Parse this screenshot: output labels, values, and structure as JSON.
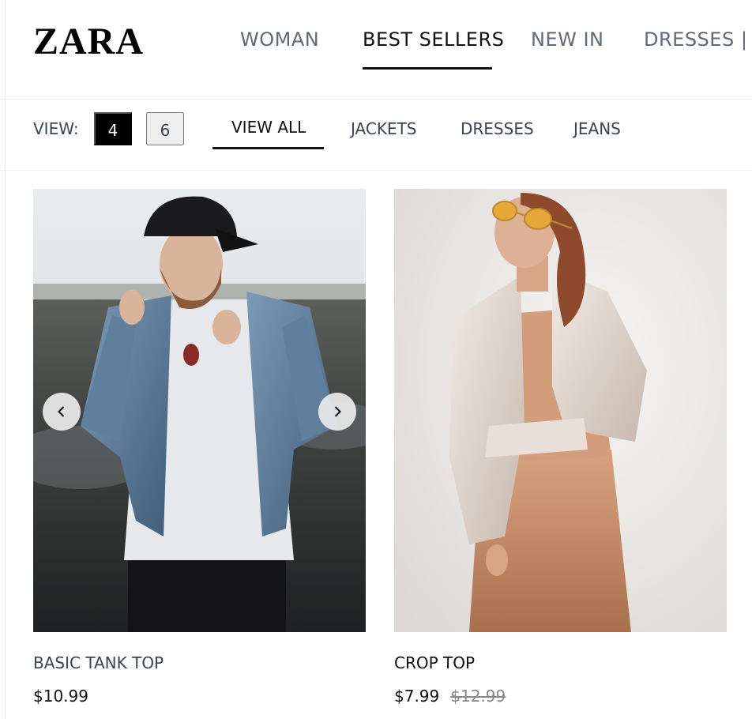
{
  "brand": {
    "logo": "ZARA"
  },
  "main_nav": [
    {
      "label": "WOMAN",
      "active": false
    },
    {
      "label": "BEST SELLERS",
      "active": true
    },
    {
      "label": "NEW IN",
      "active": false
    },
    {
      "label": "DRESSES | J",
      "active": false
    }
  ],
  "view": {
    "label": "VIEW:",
    "options": [
      "4",
      "6"
    ],
    "selected": "4"
  },
  "categories": [
    {
      "label": "VIEW ALL",
      "active": true
    },
    {
      "label": "JACKETS",
      "active": false
    },
    {
      "label": "DRESSES",
      "active": false
    },
    {
      "label": "JEANS",
      "active": false
    }
  ],
  "products": [
    {
      "name": "BASIC TANK TOP",
      "price": "$10.99",
      "old_price": "",
      "image_icon": "product-photo-denim-jacket-man",
      "has_carousel": true
    },
    {
      "name": "CROP TOP",
      "price": "$7.99",
      "old_price": "$12.99",
      "image_icon": "product-photo-woman-shirt-sunglasses",
      "has_carousel": false
    }
  ],
  "colors": {
    "accent": "#000000",
    "muted_text": "#3b4550",
    "nav_text": "#616a75",
    "strike_price": "#888888"
  },
  "icons": {
    "prev": "chevron-left-icon",
    "next": "chevron-right-icon"
  }
}
